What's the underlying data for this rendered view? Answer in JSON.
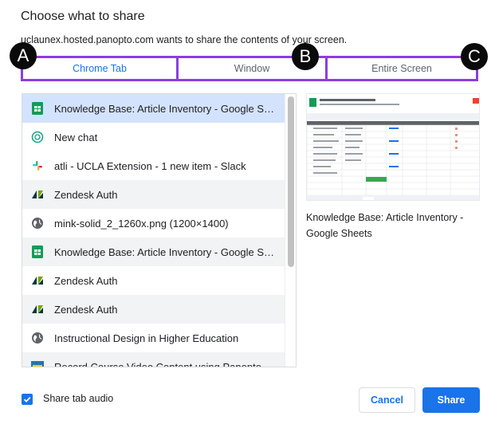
{
  "dialog": {
    "title": "Choose what to share",
    "subtitle": "uclaunex.hosted.panopto.com wants to share the contents of your screen."
  },
  "tabs": [
    {
      "label": "Chrome Tab",
      "active": true
    },
    {
      "label": "Window",
      "active": false
    },
    {
      "label": "Entire Screen",
      "active": false
    }
  ],
  "markers": [
    "A",
    "B",
    "C"
  ],
  "list": {
    "items": [
      {
        "label": "Knowledge Base: Article Inventory - Google Sh…",
        "icon": "google-sheets-icon",
        "selected": true
      },
      {
        "label": "New chat",
        "icon": "chatgpt-icon",
        "selected": false
      },
      {
        "label": "atli - UCLA Extension - 1 new item - Slack",
        "icon": "slack-icon",
        "selected": false
      },
      {
        "label": "Zendesk Auth",
        "icon": "zendesk-icon",
        "selected": false
      },
      {
        "label": "mink-solid_2_1260x.png (1200×1400)",
        "icon": "globe-icon",
        "selected": false
      },
      {
        "label": "Knowledge Base: Article Inventory - Google Sh…",
        "icon": "google-sheets-icon",
        "selected": false
      },
      {
        "label": "Zendesk Auth",
        "icon": "zendesk-icon",
        "selected": false
      },
      {
        "label": "Zendesk Auth",
        "icon": "zendesk-icon",
        "selected": false
      },
      {
        "label": "Instructional Design in Higher Education",
        "icon": "globe-icon",
        "selected": false
      },
      {
        "label": "Record Course Video Content using Panopto –",
        "icon": "ucla-icon",
        "selected": false
      }
    ]
  },
  "preview": {
    "caption": "Knowledge Base: Article Inventory - Google Sheets"
  },
  "footer": {
    "share_audio_label": "Share tab audio",
    "share_audio_checked": true,
    "cancel_label": "Cancel",
    "share_label": "Share"
  },
  "colors": {
    "accent": "#1a73e8",
    "annotation": "#8a3fe0",
    "selected_row": "#d3e3fd",
    "sheets_green": "#0f9d58"
  }
}
